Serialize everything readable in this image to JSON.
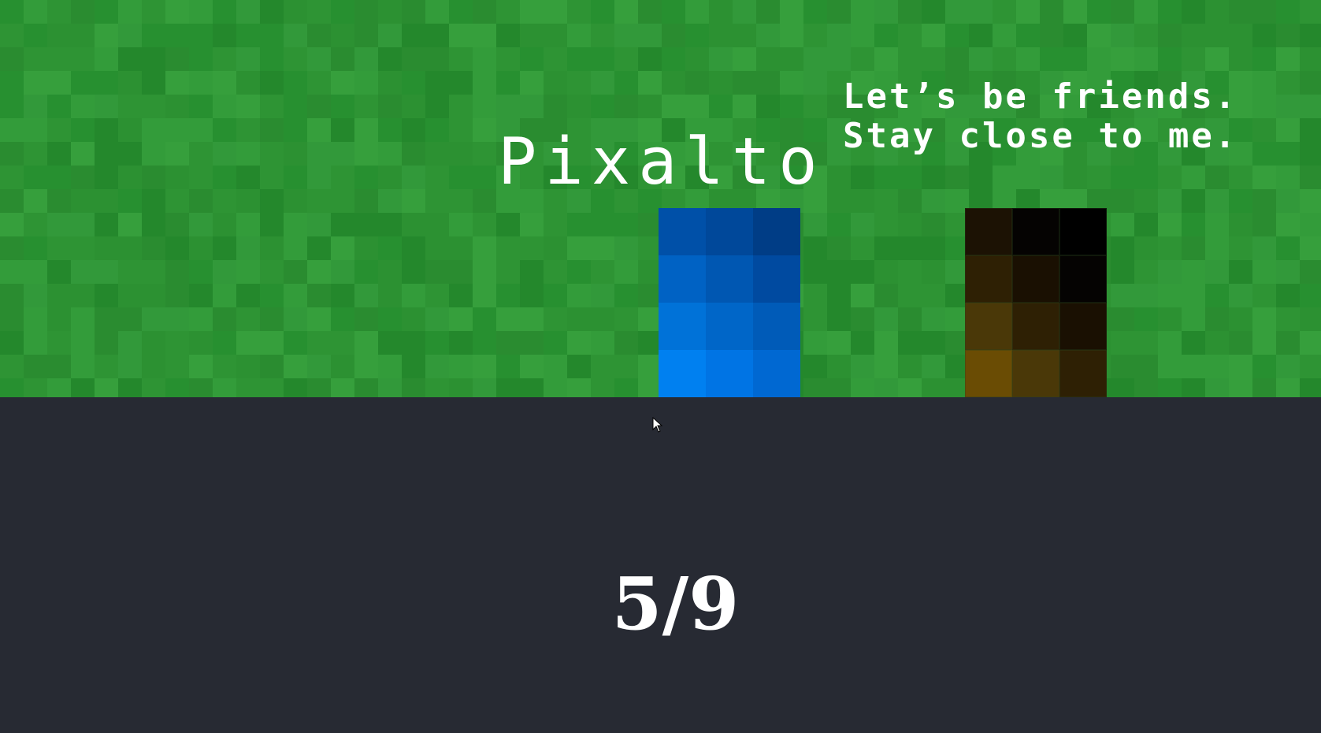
{
  "player": {
    "name": "Pixalto",
    "colors": [
      "#0050a8",
      "#00489a",
      "#003d86",
      "#0062c4",
      "#0057b2",
      "#004aa0",
      "#0072d8",
      "#0066c8",
      "#005bb8",
      "#0080f0",
      "#0074e4",
      "#0068d2"
    ]
  },
  "npc": {
    "dialogue": [
      "Let’s be friends.",
      "Stay close to me."
    ],
    "colors": [
      "#1c1204",
      "#050302",
      "#000000",
      "#2e2004",
      "#1a1002",
      "#050302",
      "#4a3808",
      "#2e2004",
      "#1a1002",
      "#6a4c04",
      "#4a3808",
      "#2e2004"
    ]
  },
  "hud": {
    "level_counter": "5/9"
  },
  "scene": {
    "grass_color": "#2e9434",
    "ground_color": "#272a33"
  }
}
